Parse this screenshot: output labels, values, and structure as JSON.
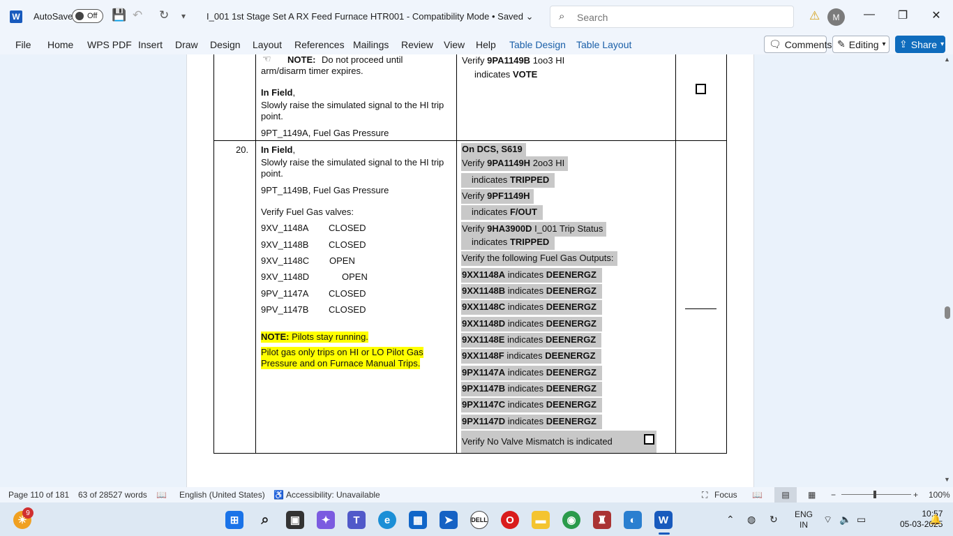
{
  "titlebar": {
    "app_icon": "word-icon",
    "autosave_label": "AutoSave",
    "autosave_state": "Off",
    "document_title": "I_001 1st Stage Set A RX Feed Furnace HTR001  -  Compatibility Mode • Saved",
    "search_placeholder": "Search",
    "avatar_initial": "M"
  },
  "ribbon": {
    "tabs": [
      "File",
      "Home",
      "WPS PDF",
      "Insert",
      "Draw",
      "Design",
      "Layout",
      "References",
      "Mailings",
      "Review",
      "View",
      "Help",
      "Table Design",
      "Table Layout"
    ],
    "comments_label": "Comments",
    "editing_label": "Editing",
    "share_label": "Share"
  },
  "document": {
    "row19": {
      "note_label": "NOTE:",
      "note_text": "Do not proceed until",
      "note_text2": "arm/disarm timer expires.",
      "in_field": "In Field",
      "comma": ",",
      "raise_line1": "Slowly raise the simulated signal to the HI trip",
      "raise_line2": "point.",
      "tag_line": "9PT_1149A, Fuel Gas Pressure",
      "verify_word": "Verify",
      "verify_tag": "9PA1149B",
      "verify_rest": "1oo3 HI",
      "indicates": "indicates",
      "vote": "VOTE"
    },
    "row20": {
      "step": "20.",
      "in_field": "In Field",
      "comma": ",",
      "raise_line1": "Slowly raise the simulated signal to the HI trip",
      "raise_line2": "point.",
      "tag_line": "9PT_1149B, Fuel Gas Pressure",
      "verify_valves": "Verify Fuel Gas valves:",
      "valves": [
        {
          "tag": "9XV_1148A",
          "state": "CLOSED"
        },
        {
          "tag": "9XV_1148B",
          "state": "CLOSED"
        },
        {
          "tag": "9XV_1148C",
          "state": "OPEN"
        },
        {
          "tag": "9XV_1148D",
          "state": "OPEN"
        },
        {
          "tag": "9PV_1147A",
          "state": "CLOSED"
        },
        {
          "tag": "9PV_1147B",
          "state": "CLOSED"
        }
      ],
      "note_label": "NOTE:",
      "note_text": "Pilots stay running.",
      "pilot_line1": "Pilot gas only trips on HI or LO Pilot Gas",
      "pilot_line2": "Pressure and on Furnace Manual Trips.",
      "dcs_header": "On DCS, S619",
      "verify_word": "Verify",
      "v1_tag": "9PA1149H",
      "v1_rest": "2oo3 HI",
      "indicates": "indicates",
      "tripped": "TRIPPED",
      "v2_tag": "9PF1149H",
      "fout": "F/OUT",
      "v3_tag": "9HA3900D",
      "v3_rest": "I_001 Trip Status",
      "fuel_outputs": "Verify the following Fuel Gas Outputs:",
      "outputs": [
        "9XX1148A",
        "9XX1148B",
        "9XX1148C",
        "9XX1148D",
        "9XX1148E",
        "9XX1148F",
        "9PX1147A",
        "9PX1147B",
        "9PX1147C",
        "9PX1147D"
      ],
      "deenergz": "DEENERGZ",
      "mismatch": "Verify No Valve Mismatch is indicated"
    }
  },
  "statusbar": {
    "page": "Page 110 of 181",
    "words": "63 of 28527 words",
    "language": "English (United States)",
    "accessibility": "Accessibility: Unavailable",
    "focus": "Focus",
    "zoom": "100%"
  },
  "taskbar": {
    "badge": "9",
    "lang_top": "ENG",
    "lang_bottom": "IN",
    "time": "10:57",
    "date": "05-03-2025"
  }
}
